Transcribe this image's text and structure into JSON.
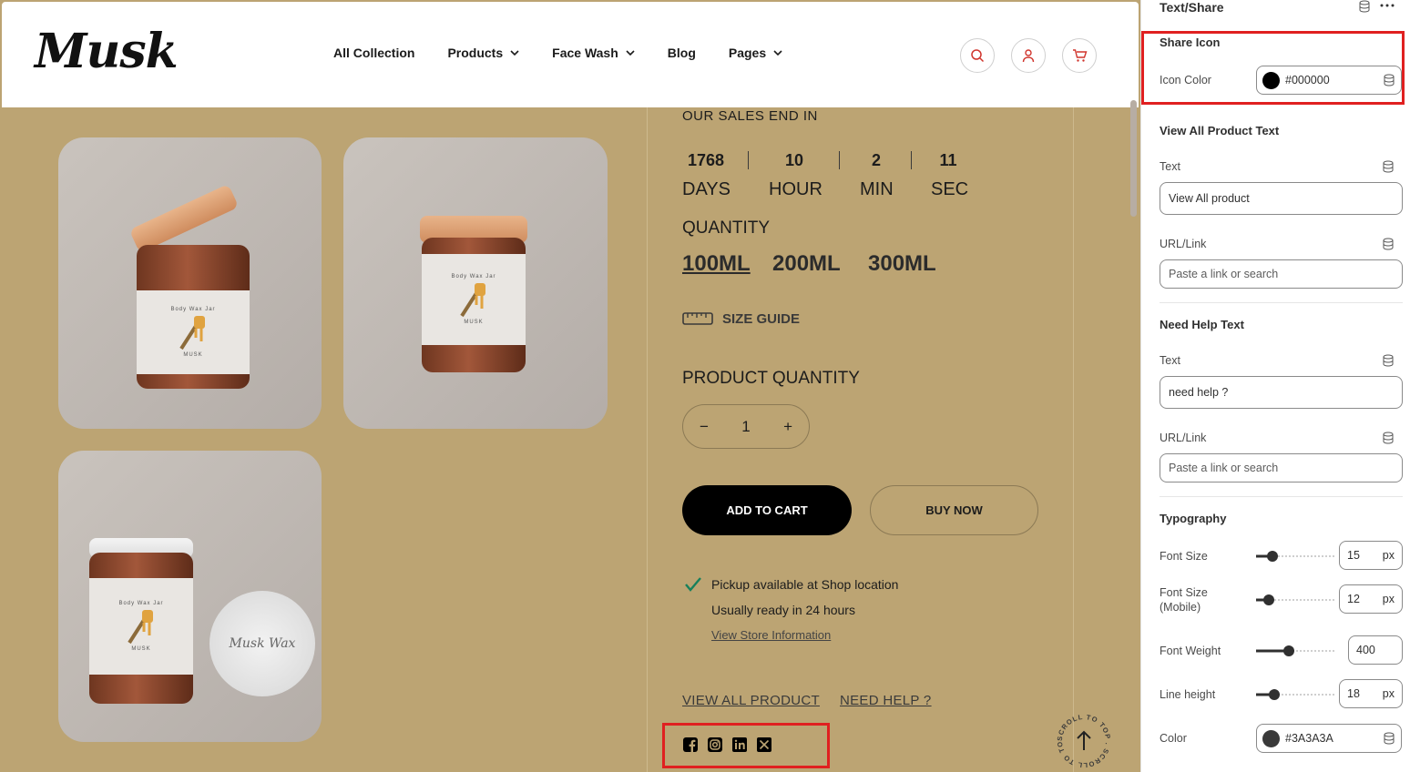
{
  "header": {
    "logo": "Musk",
    "nav": [
      {
        "label": "All Collection",
        "dropdown": false
      },
      {
        "label": "Products",
        "dropdown": true
      },
      {
        "label": "Face Wash",
        "dropdown": true
      },
      {
        "label": "Blog",
        "dropdown": false
      },
      {
        "label": "Pages",
        "dropdown": true
      }
    ],
    "icons": [
      "search-icon",
      "user-icon",
      "cart-icon"
    ],
    "icon_color": "#d0342c"
  },
  "product_images": [
    {
      "jar_label": "Body Wax Jar",
      "brand": "MUSK"
    },
    {
      "jar_label": "Body Wax Jar",
      "brand": "MUSK"
    },
    {
      "jar_label": "Body Wax Jar",
      "brand": "MUSK",
      "lid_text": "Musk Wax"
    }
  ],
  "product": {
    "sales_title": "OUR SALES END IN",
    "countdown": [
      {
        "value": "1768",
        "label": "DAYS"
      },
      {
        "value": "10",
        "label": "HOUR"
      },
      {
        "value": "2",
        "label": "MIN"
      },
      {
        "value": "11",
        "label": "SEC"
      }
    ],
    "quantity_title": "QUANTITY",
    "sizes": [
      "100ML",
      "200ML",
      "300ML"
    ],
    "selected_size": "100ML",
    "size_guide": "SIZE GUIDE",
    "product_quantity_title": "PRODUCT QUANTITY",
    "qty_minus": "−",
    "qty_value": "1",
    "qty_plus": "+",
    "add_to_cart": "ADD TO CART",
    "buy_now": "BUY NOW",
    "pickup_text": "Pickup available at Shop location",
    "ready_text": "Usually ready in 24 hours",
    "store_link": "View Store Information",
    "view_all": "VIEW ALL PRODUCT",
    "need_help": "NEED HELP ?",
    "share_icons": [
      "facebook-icon",
      "instagram-icon",
      "linkedin-icon",
      "x-icon"
    ],
    "scroll_top": "SCROLL TO TOP . SCROLL TO TOP .",
    "background": "#bca473"
  },
  "panel": {
    "title": "Text/Share",
    "share_icon": {
      "section": "Share Icon",
      "icon_color_label": "Icon Color",
      "icon_color_value": "#000000"
    },
    "view_all": {
      "section": "View All Product Text",
      "text_label": "Text",
      "text_value": "View All product",
      "url_label": "URL/Link",
      "url_placeholder": "Paste a link or search"
    },
    "need_help": {
      "section": "Need Help Text",
      "text_label": "Text",
      "text_value": "need help ?",
      "url_label": "URL/Link",
      "url_placeholder": "Paste a link or search"
    },
    "typography": {
      "section": "Typography",
      "font_size_label": "Font Size",
      "font_size_value": "15",
      "font_size_mobile_label_1": "Font Size",
      "font_size_mobile_label_2": "(Mobile)",
      "font_size_mobile_value": "12",
      "font_weight_label": "Font Weight",
      "font_weight_value": "400",
      "line_height_label": "Line height",
      "line_height_value": "18",
      "unit": "px",
      "color_label": "Color",
      "color_value": "#3A3A3A"
    }
  }
}
